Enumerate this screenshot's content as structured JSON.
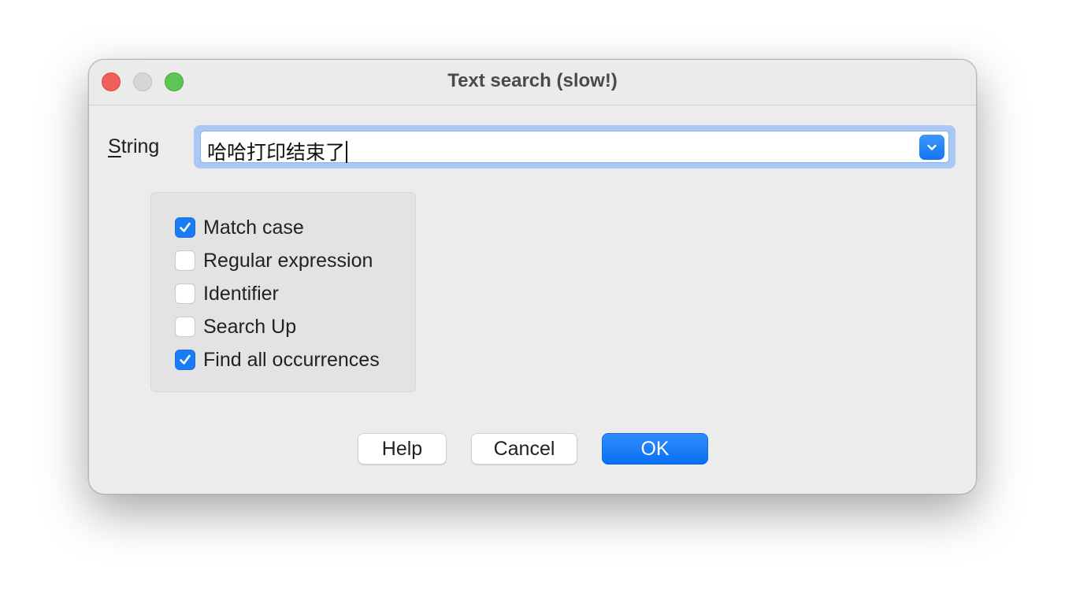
{
  "window": {
    "title": "Text search (slow!)"
  },
  "search": {
    "label_mnemonic": "S",
    "label_rest": "tring",
    "value": "哈哈打印结束了",
    "dropdown_icon": "chevron-down-icon"
  },
  "options": [
    {
      "label": "Match case",
      "checked": true
    },
    {
      "label": "Regular expression",
      "checked": false
    },
    {
      "label": "Identifier",
      "checked": false
    },
    {
      "label": "Search Up",
      "checked": false
    },
    {
      "label": "Find all occurrences",
      "checked": true
    }
  ],
  "buttons": {
    "help": "Help",
    "cancel": "Cancel",
    "ok": "OK"
  },
  "colors": {
    "accent": "#1a7cf5",
    "close": "#ee5f57",
    "minimize": "#d6d6d6",
    "maximize": "#5ec453"
  }
}
